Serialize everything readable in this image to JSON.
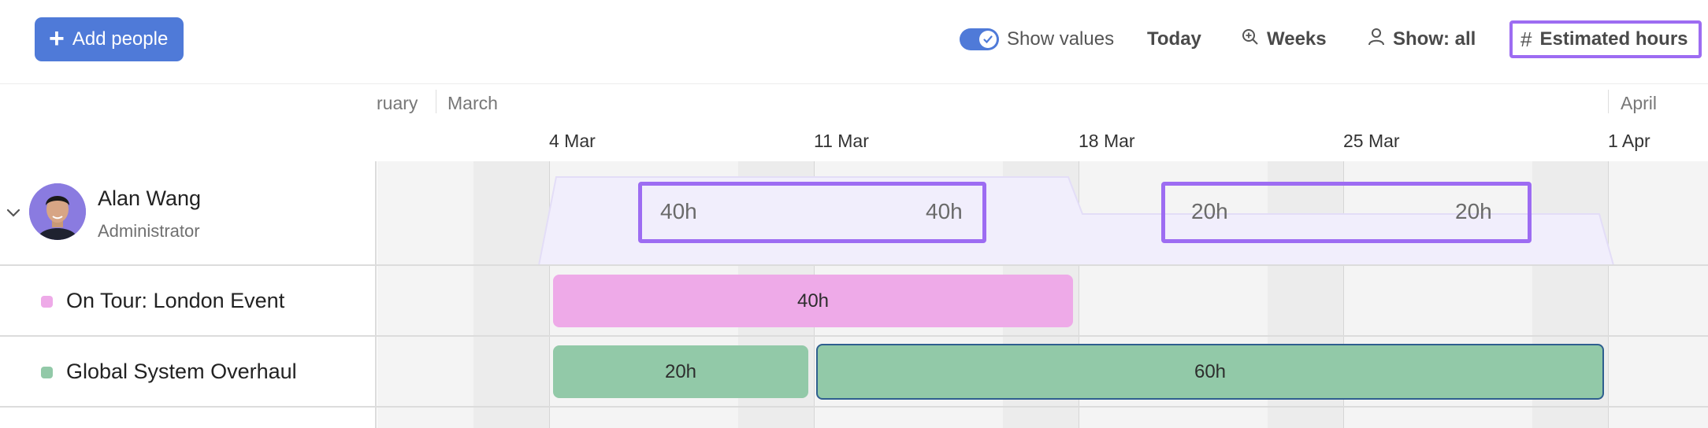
{
  "toolbar": {
    "add_people_label": "Add people",
    "show_values_label": "Show values",
    "show_values_on": true,
    "today_label": "Today",
    "weeks_label": "Weeks",
    "show_all_label": "Show: all",
    "estimated_hours_label": "Estimated hours"
  },
  "timeline": {
    "months": [
      "ruary",
      "March",
      "April"
    ],
    "weeks": [
      "4 Mar",
      "11 Mar",
      "18 Mar",
      "25 Mar",
      "1 Apr"
    ]
  },
  "person": {
    "name": "Alan Wang",
    "role": "Administrator",
    "summary_values": [
      "40h",
      "40h",
      "20h",
      "20h"
    ]
  },
  "projects": [
    {
      "name": "On Tour: London Event",
      "color": "#eeaae8",
      "bars": [
        {
          "label": "40h"
        }
      ]
    },
    {
      "name": "Global System Overhaul",
      "color": "#92c9a8",
      "bars": [
        {
          "label": "20h"
        },
        {
          "label": "60h"
        }
      ]
    }
  ],
  "colors": {
    "accent": "#4f7ad8",
    "highlight": "#9d6cf2",
    "pink": "#eeaae8",
    "green": "#92c9a8"
  }
}
